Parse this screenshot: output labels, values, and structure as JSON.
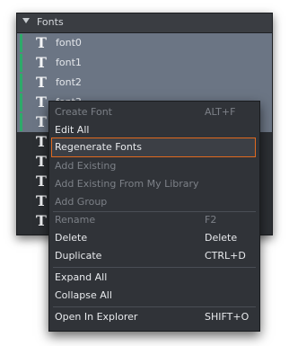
{
  "panel": {
    "title": "Fonts",
    "items": [
      {
        "label": "font0"
      },
      {
        "label": "font1"
      },
      {
        "label": "font2"
      },
      {
        "label": "font3"
      },
      {
        "label": ""
      },
      {
        "label": ""
      },
      {
        "label": ""
      },
      {
        "label": ""
      },
      {
        "label": ""
      },
      {
        "label": ""
      }
    ]
  },
  "context_menu": {
    "items": [
      {
        "label": "Create Font",
        "shortcut": "ALT+F",
        "enabled": false
      },
      {
        "label": "Edit All",
        "shortcut": "",
        "enabled": true
      },
      {
        "label": "Regenerate Fonts",
        "shortcut": "",
        "enabled": true,
        "highlighted": true
      },
      {
        "label": "Add Existing",
        "shortcut": "",
        "enabled": false
      },
      {
        "label": "Add Existing From My Library",
        "shortcut": "",
        "enabled": false
      },
      {
        "label": "Add Group",
        "shortcut": "",
        "enabled": false
      },
      {
        "label": "Rename",
        "shortcut": "F2",
        "enabled": false
      },
      {
        "label": "Delete",
        "shortcut": "Delete",
        "enabled": true
      },
      {
        "label": "Duplicate",
        "shortcut": "CTRL+D",
        "enabled": true
      },
      {
        "label": "Expand All",
        "shortcut": "",
        "enabled": true
      },
      {
        "label": "Collapse All",
        "shortcut": "",
        "enabled": true
      },
      {
        "label": "Open In Explorer",
        "shortcut": "SHIFT+O",
        "enabled": true
      }
    ]
  },
  "colors": {
    "accent_highlight": "#e06a1f",
    "selection_bar": "#2eaa6a",
    "selected_row": "#6b7584"
  },
  "icons": {
    "collapse": "triangle-down-icon",
    "font": "font-t-icon",
    "font_glyph": "T"
  }
}
